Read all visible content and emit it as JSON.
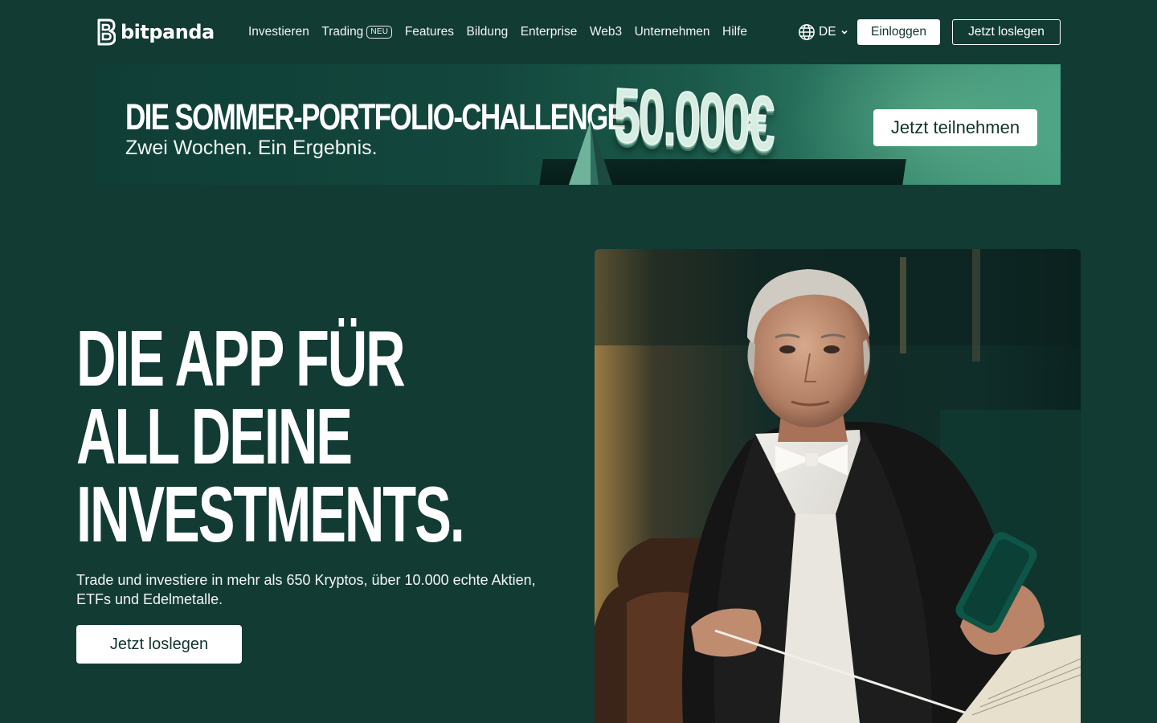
{
  "brand": {
    "name": "bitpanda",
    "bg_color": "#123b34",
    "logo_icon": "bitpanda-b-logo-icon"
  },
  "nav": {
    "items": [
      {
        "label": "Investieren"
      },
      {
        "label": "Trading",
        "badge": "NEU"
      },
      {
        "label": "Features"
      },
      {
        "label": "Bildung"
      },
      {
        "label": "Enterprise"
      },
      {
        "label": "Web3"
      },
      {
        "label": "Unternehmen"
      },
      {
        "label": "Hilfe"
      }
    ],
    "language": "DE",
    "language_icon": "globe-icon",
    "login_label": "Einloggen",
    "start_label": "Jetzt loslegen"
  },
  "banner": {
    "title": "DIE SOMMER-PORTFOLIO-CHALLENGE",
    "subtitle": "Zwei Wochen. Ein Ergebnis.",
    "prize": "50.000€",
    "cta_label": "Jetzt teilnehmen"
  },
  "hero": {
    "headline_lines": [
      "DIE APP FÜR",
      "ALL DEINE",
      "INVESTMENTS."
    ],
    "description": "Trade und investiere in mehr als 650 Kryptos, über 10.000 echte Aktien, ETFs und Edelmetalle.",
    "cta_label": "Jetzt loslegen",
    "image_icon": "portrait-photo"
  }
}
